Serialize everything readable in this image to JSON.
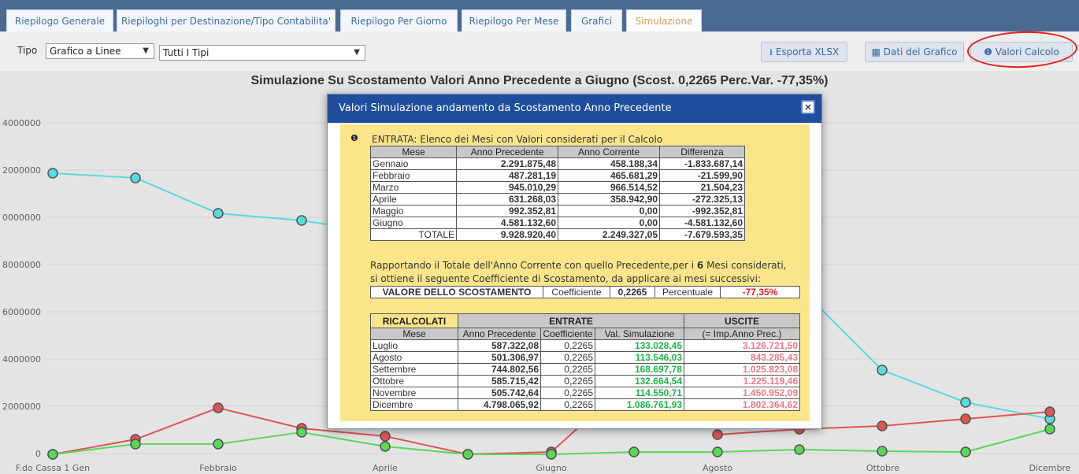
{
  "tabs": [
    "Riepilogo Generale",
    "Riepiloghi per Destinazione/Tipo Contabilita'",
    "Riepilogo Per Giorno",
    "Riepilogo Per Mese",
    "Grafici",
    "Simulazione"
  ],
  "toolbar": {
    "tipo_label": "Tipo",
    "chart_type": "Grafico a Linee",
    "tipi_filter": "Tutti I Tipi",
    "export_label": "Esporta XLSX",
    "data_label": "Dati del Grafico",
    "calc_label": "Valori Calcolo"
  },
  "chart_title": "Simulazione Su Scostamento Valori Anno Precedente a Giugno (Scost. 0,2265 Perc.Var. -77,35%)",
  "chart_data": {
    "type": "line",
    "y_tick_labels": [
      "4000000",
      "2000000",
      "0000000",
      "8000000",
      "6000000",
      "4000000",
      "2000000",
      "0"
    ],
    "x_tick_labels": [
      "F.do Cassa 1 Gen",
      "Febbraio",
      "Aprile",
      "Giugno",
      "Agosto",
      "Ottobre",
      "Dicembre"
    ],
    "colors": {
      "cyan": "#5ee3e8",
      "red": "#e65a5a",
      "green": "#5ee05e"
    }
  },
  "modal": {
    "title": "Valori Simulazione andamento da Scostamento Anno Precedente",
    "close": "×",
    "entrata_heading": "ENTRATA: Elenco dei Mesi con Valori considerati per il Calcolo",
    "table1_headers": [
      "Mese",
      "Anno Precedente",
      "Anno Corrente",
      "Differenza"
    ],
    "table1_rows": [
      [
        "Gennaio",
        "2.291.875,48",
        "458.188,34",
        "-1.833.687,14"
      ],
      [
        "Febbraio",
        "487.281,19",
        "465.681,29",
        "-21.599,90"
      ],
      [
        "Marzo",
        "945.010,29",
        "966.514,52",
        "21.504,23"
      ],
      [
        "Aprile",
        "631.268,03",
        "358.942,90",
        "-272.325,13"
      ],
      [
        "Maggio",
        "992.352,81",
        "0,00",
        "-992.352,81"
      ],
      [
        "Giugno",
        "4.581.132,60",
        "0,00",
        "-4.581.132,60"
      ]
    ],
    "table1_total": [
      "TOTALE",
      "9.928.920,40",
      "2.249.327,05",
      "-7.679.593,35"
    ],
    "text_line1_pre": "Rapportando il Totale dell'Anno Corrente con quello Precedente,per i ",
    "text_line1_bold": "6",
    "text_line1_post": " Mesi considerati,",
    "text_line2": "si ottiene il seguente Coefficiente di Scostamento, da applicare ai mesi successivi:",
    "scost": {
      "label": "VALORE DELLO SCOSTAMENTO",
      "coef_label": "Coefficiente",
      "coef_value": "0,2265",
      "perc_label": "Percentuale",
      "perc_value": "-77,35%"
    },
    "table2_group": [
      "RICALCOLATI",
      "ENTRATE",
      "USCITE"
    ],
    "table2_headers": [
      "Mese",
      "Anno Precedente",
      "Coefficiente",
      "Val. Simulazione",
      "(= Imp.Anno Prec.)"
    ],
    "table2_rows": [
      [
        "Luglio",
        "587.322,08",
        "0,2265",
        "133.028,45",
        "3.126.721,50"
      ],
      [
        "Agosto",
        "501.306,97",
        "0,2265",
        "113.546,03",
        "843.285,43"
      ],
      [
        "Settembre",
        "744.802,56",
        "0,2265",
        "168.697,78",
        "1.025.823,08"
      ],
      [
        "Ottobre",
        "585.715,42",
        "0,2265",
        "132.664,54",
        "1.225.119,46"
      ],
      [
        "Novembre",
        "505.742,64",
        "0,2265",
        "114.550,71",
        "1.450.952,09"
      ],
      [
        "Dicembre",
        "4.798.065,92",
        "0,2265",
        "1.086.761,93",
        "1.802.364,62"
      ]
    ]
  }
}
